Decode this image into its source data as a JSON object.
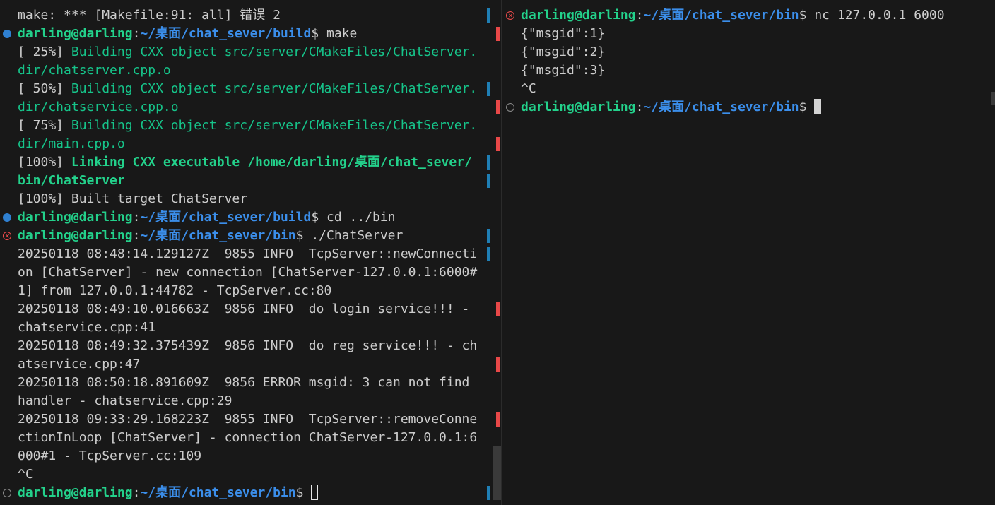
{
  "left_terminal": {
    "lines": [
      {
        "deco": "",
        "segments": [
          {
            "t": "make: *** [Makefile:91: all] 错误 2",
            "c": "plain"
          }
        ]
      },
      {
        "deco": "success",
        "segments": [
          {
            "t": "darling@darling",
            "c": "green"
          },
          {
            "t": ":",
            "c": "plain"
          },
          {
            "t": "~/桌面/chat_sever/build",
            "c": "blue"
          },
          {
            "t": "$ make",
            "c": "plain"
          }
        ]
      },
      {
        "deco": "",
        "segments": [
          {
            "t": "[ 25%] ",
            "c": "plain"
          },
          {
            "t": "Building CXX object src/server/CMakeFiles/ChatServer.",
            "c": "greenn"
          }
        ]
      },
      {
        "deco": "",
        "segments": [
          {
            "t": "dir/chatserver.cpp.o",
            "c": "greenn"
          }
        ]
      },
      {
        "deco": "",
        "segments": [
          {
            "t": "[ 50%] ",
            "c": "plain"
          },
          {
            "t": "Building CXX object src/server/CMakeFiles/ChatServer.",
            "c": "greenn"
          }
        ]
      },
      {
        "deco": "",
        "segments": [
          {
            "t": "dir/chatservice.cpp.o",
            "c": "greenn"
          }
        ]
      },
      {
        "deco": "",
        "segments": [
          {
            "t": "[ 75%] ",
            "c": "plain"
          },
          {
            "t": "Building CXX object src/server/CMakeFiles/ChatServer.",
            "c": "greenn"
          }
        ]
      },
      {
        "deco": "",
        "segments": [
          {
            "t": "dir/main.cpp.o",
            "c": "greenn"
          }
        ]
      },
      {
        "deco": "",
        "segments": [
          {
            "t": "[100%] ",
            "c": "plain"
          },
          {
            "t": "Linking CXX executable /home/darling/桌面/chat_sever/",
            "c": "green"
          }
        ]
      },
      {
        "deco": "",
        "segments": [
          {
            "t": "bin/ChatServer",
            "c": "green"
          }
        ]
      },
      {
        "deco": "",
        "segments": [
          {
            "t": "[100%] Built target ChatServer",
            "c": "plain"
          }
        ]
      },
      {
        "deco": "success",
        "segments": [
          {
            "t": "darling@darling",
            "c": "green"
          },
          {
            "t": ":",
            "c": "plain"
          },
          {
            "t": "~/桌面/chat_sever/build",
            "c": "blue"
          },
          {
            "t": "$ cd ../bin",
            "c": "plain"
          }
        ]
      },
      {
        "deco": "error",
        "segments": [
          {
            "t": "darling@darling",
            "c": "green"
          },
          {
            "t": ":",
            "c": "plain"
          },
          {
            "t": "~/桌面/chat_sever/bin",
            "c": "blue"
          },
          {
            "t": "$ ./ChatServer",
            "c": "plain"
          }
        ]
      },
      {
        "deco": "",
        "segments": [
          {
            "t": "20250118 08:48:14.129127Z  9855 INFO  TcpServer::newConnecti",
            "c": "plain"
          }
        ]
      },
      {
        "deco": "",
        "segments": [
          {
            "t": "on [ChatServer] - new connection [ChatServer-127.0.0.1:6000#",
            "c": "plain"
          }
        ]
      },
      {
        "deco": "",
        "segments": [
          {
            "t": "1] from 127.0.0.1:44782 - TcpServer.cc:80",
            "c": "plain"
          }
        ]
      },
      {
        "deco": "",
        "segments": [
          {
            "t": "20250118 08:49:10.016663Z  9856 INFO  do login service!!! -",
            "c": "plain"
          }
        ]
      },
      {
        "deco": "",
        "segments": [
          {
            "t": "chatservice.cpp:41",
            "c": "plain"
          }
        ]
      },
      {
        "deco": "",
        "segments": [
          {
            "t": "20250118 08:49:32.375439Z  9856 INFO  do reg service!!! - ch",
            "c": "plain"
          }
        ]
      },
      {
        "deco": "",
        "segments": [
          {
            "t": "atservice.cpp:47",
            "c": "plain"
          }
        ]
      },
      {
        "deco": "",
        "segments": [
          {
            "t": "20250118 08:50:18.891609Z  9856 ERROR msgid: 3 can not find",
            "c": "plain"
          }
        ]
      },
      {
        "deco": "",
        "segments": [
          {
            "t": "handler - chatservice.cpp:29",
            "c": "plain"
          }
        ]
      },
      {
        "deco": "",
        "segments": [
          {
            "t": "20250118 09:33:29.168223Z  9855 INFO  TcpServer::removeConne",
            "c": "plain"
          }
        ]
      },
      {
        "deco": "",
        "segments": [
          {
            "t": "ctionInLoop [ChatServer] - connection ChatServer-127.0.0.1:6",
            "c": "plain"
          }
        ]
      },
      {
        "deco": "",
        "segments": [
          {
            "t": "000#1 - TcpServer.cc:109",
            "c": "plain"
          }
        ]
      },
      {
        "deco": "",
        "segments": [
          {
            "t": "^C",
            "c": "plain"
          }
        ]
      },
      {
        "deco": "default",
        "segments": [
          {
            "t": "darling@darling",
            "c": "green"
          },
          {
            "t": ":",
            "c": "plain"
          },
          {
            "t": "~/桌面/chat_sever/bin",
            "c": "blue"
          },
          {
            "t": "$ ",
            "c": "plain"
          }
        ],
        "cursor": "outline"
      }
    ],
    "gutter_marks": [
      "blue",
      "red",
      "",
      "",
      "blue",
      "red",
      "",
      "red",
      "blue",
      "blue",
      "",
      "",
      "blue",
      "blue",
      "",
      "",
      "red",
      "",
      "",
      "red",
      "",
      "",
      "red",
      "",
      "",
      "",
      "blue-red"
    ]
  },
  "right_terminal": {
    "lines": [
      {
        "deco": "error",
        "segments": [
          {
            "t": "darling@darling",
            "c": "green"
          },
          {
            "t": ":",
            "c": "plain"
          },
          {
            "t": "~/桌面/chat_sever/bin",
            "c": "blue"
          },
          {
            "t": "$ nc 127.0.0.1 6000",
            "c": "plain"
          }
        ]
      },
      {
        "deco": "",
        "segments": [
          {
            "t": "{\"msgid\":1}",
            "c": "plain"
          }
        ]
      },
      {
        "deco": "",
        "segments": [
          {
            "t": "{\"msgid\":2}",
            "c": "plain"
          }
        ]
      },
      {
        "deco": "",
        "segments": [
          {
            "t": "{\"msgid\":3}",
            "c": "plain"
          }
        ]
      },
      {
        "deco": "",
        "segments": [
          {
            "t": "^C",
            "c": "plain"
          }
        ]
      },
      {
        "deco": "default",
        "segments": [
          {
            "t": "darling@darling",
            "c": "green"
          },
          {
            "t": ":",
            "c": "plain"
          },
          {
            "t": "~/桌面/chat_sever/bin",
            "c": "blue"
          },
          {
            "t": "$ ",
            "c": "plain"
          }
        ],
        "cursor": "solid"
      }
    ]
  }
}
